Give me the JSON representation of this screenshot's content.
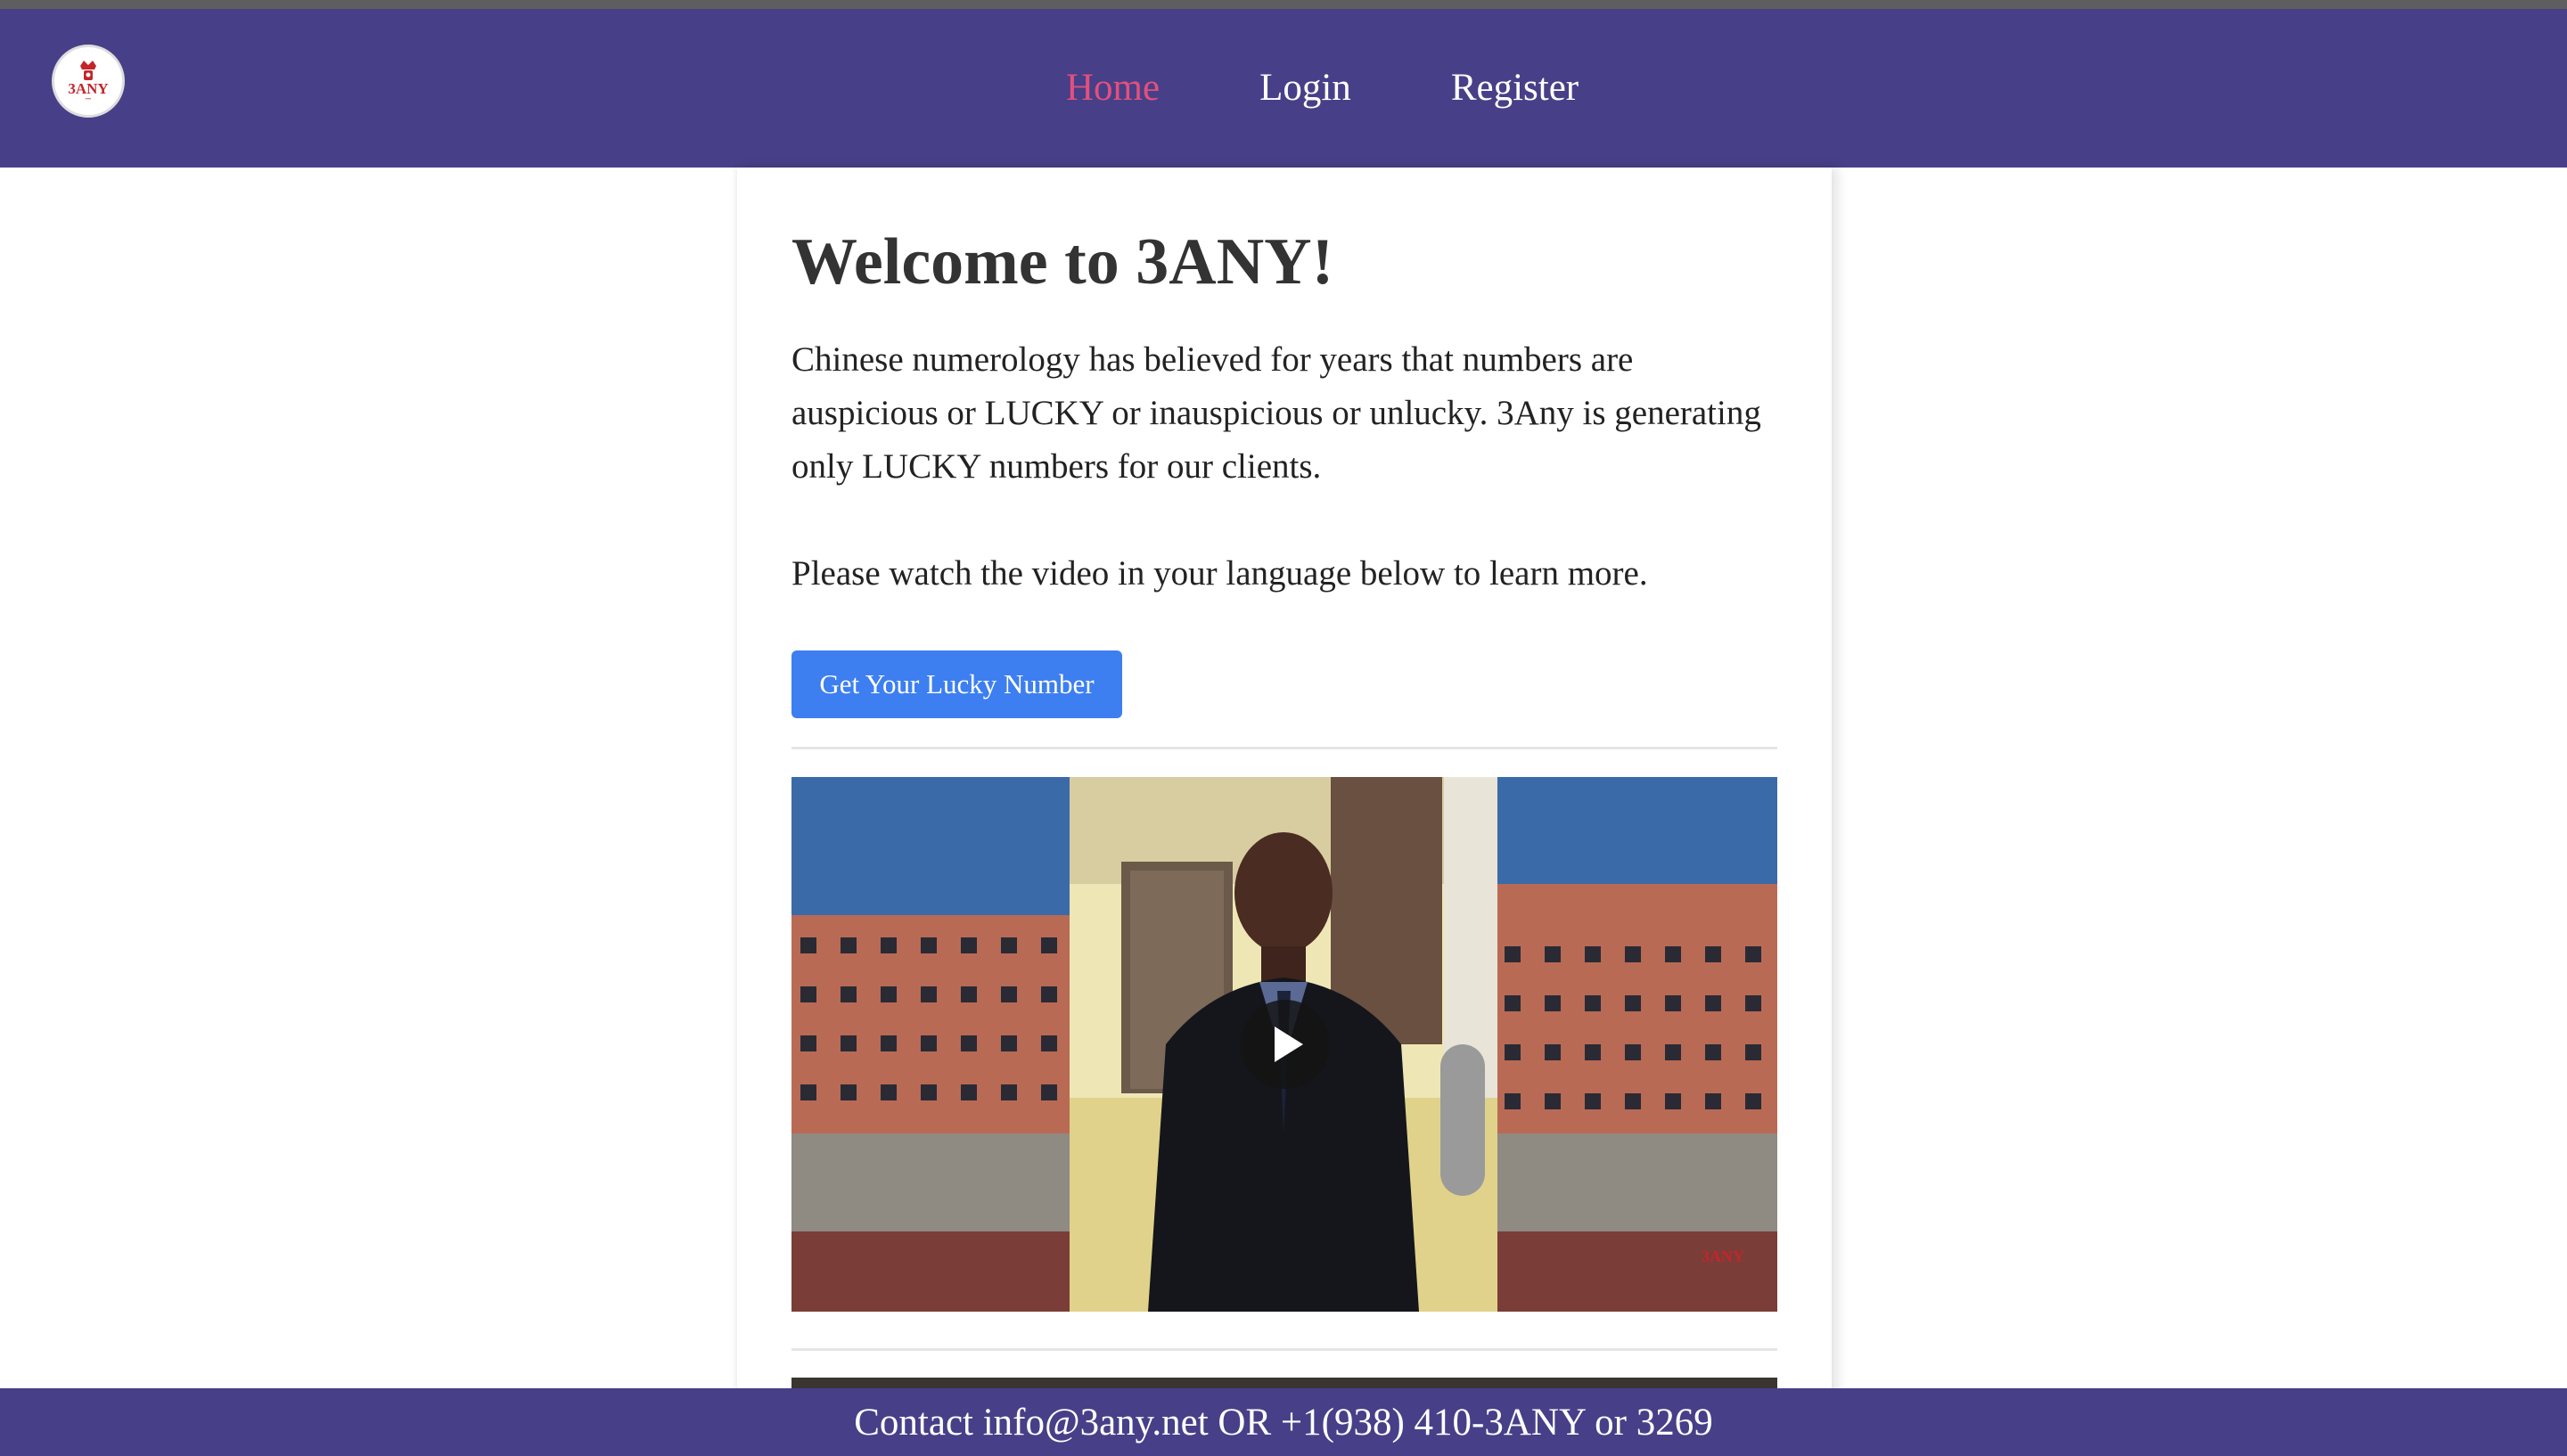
{
  "nav": {
    "logo_text": "3ANY",
    "items": [
      {
        "label": "Home",
        "active": true
      },
      {
        "label": "Login",
        "active": false
      },
      {
        "label": "Register",
        "active": false
      }
    ]
  },
  "main": {
    "heading": "Welcome to 3ANY!",
    "intro": "Chinese numerology has believed for years that numbers are auspicious or LUCKY or inauspicious or unlucky. 3Any is generating only LUCKY numbers for our clients.",
    "watch_text": "Please watch the video in your language below to learn more.",
    "cta_label": "Get Your Lucky Number"
  },
  "video": {
    "watermark": "3ANY",
    "play_icon": "play-icon"
  },
  "footer": {
    "contact": "Contact info@3any.net OR +1(938) 410-3ANY or 3269"
  },
  "colors": {
    "navbar": "#473f88",
    "active_nav": "#e2507d",
    "button": "#3d7ff0"
  }
}
